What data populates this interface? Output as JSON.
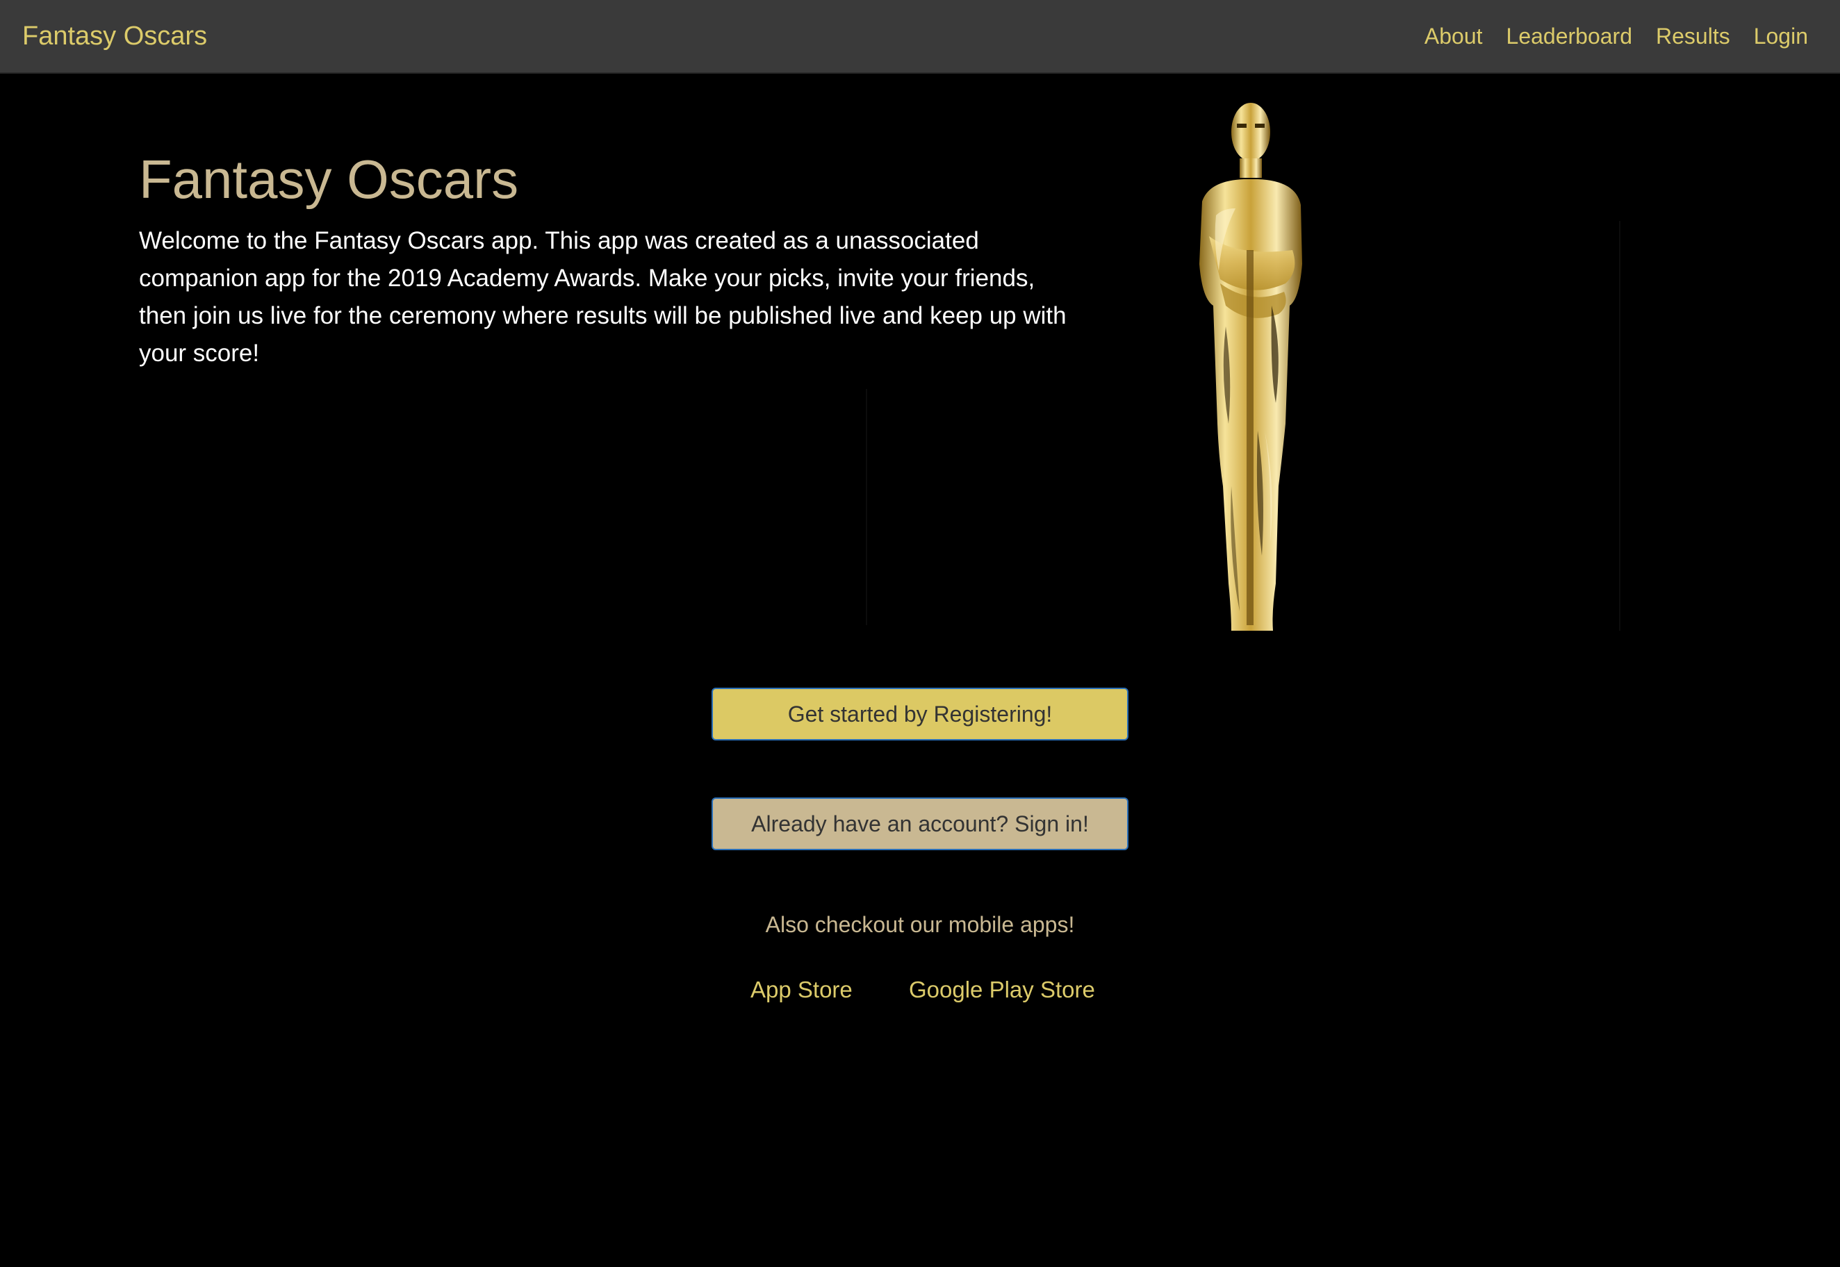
{
  "navbar": {
    "brand": "Fantasy Oscars",
    "links": [
      "About",
      "Leaderboard",
      "Results",
      "Login"
    ]
  },
  "hero": {
    "title": "Fantasy Oscars",
    "description": "Welcome to the Fantasy Oscars app. This app was created as a unassociated companion app for the 2019 Academy Awards. Make your picks, invite your friends, then join us live for the ceremony where results will be published live and keep up with your score!",
    "image": "oscar-statue-icon"
  },
  "actions": {
    "register_label": "Get started by Registering!",
    "signin_label": "Already have an account? Sign in!"
  },
  "mobile": {
    "text": "Also checkout our mobile apps!",
    "app_store": "App Store",
    "google_play": "Google Play Store"
  },
  "colors": {
    "navbar_bg": "#3a3a3a",
    "accent_gold": "#dccb6a",
    "muted_gold": "#c9b892",
    "page_bg": "#000000",
    "button_border": "#2a6fb8"
  }
}
